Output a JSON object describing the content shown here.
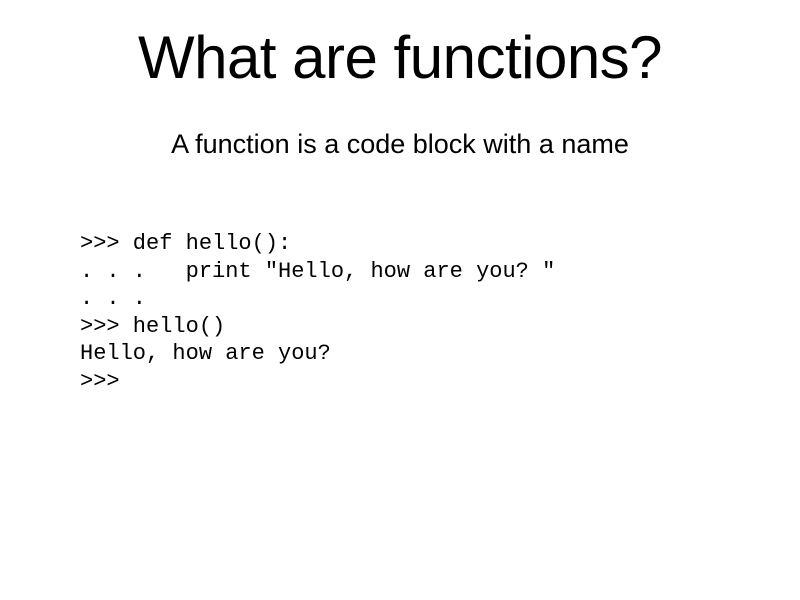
{
  "slide": {
    "title": "What are functions?",
    "subtitle": "A function is a code block with a name",
    "code": ">>> def hello():\n. . .   print \"Hello, how are you? \"\n. . .\n>>> hello()\nHello, how are you?\n>>>"
  }
}
